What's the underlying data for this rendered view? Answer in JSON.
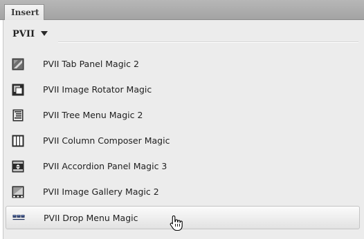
{
  "tab": {
    "label": "Insert"
  },
  "category": {
    "label": "PVII"
  },
  "items": [
    {
      "label": "PVII Tab Panel Magic 2",
      "icon": "tab-panel-icon"
    },
    {
      "label": "PVII Image Rotator Magic",
      "icon": "image-rotator-icon"
    },
    {
      "label": "PVII Tree Menu Magic 2",
      "icon": "tree-menu-icon"
    },
    {
      "label": "PVII Column Composer Magic",
      "icon": "column-composer-icon"
    },
    {
      "label": "PVII Accordion Panel Magic 3",
      "icon": "accordion-panel-icon"
    },
    {
      "label": "PVII Image Gallery Magic 2",
      "icon": "image-gallery-icon"
    },
    {
      "label": "PVII Drop Menu Magic",
      "icon": "drop-menu-icon",
      "hovered": true
    }
  ],
  "cursor": {
    "icon": "hand-pointer-icon"
  }
}
